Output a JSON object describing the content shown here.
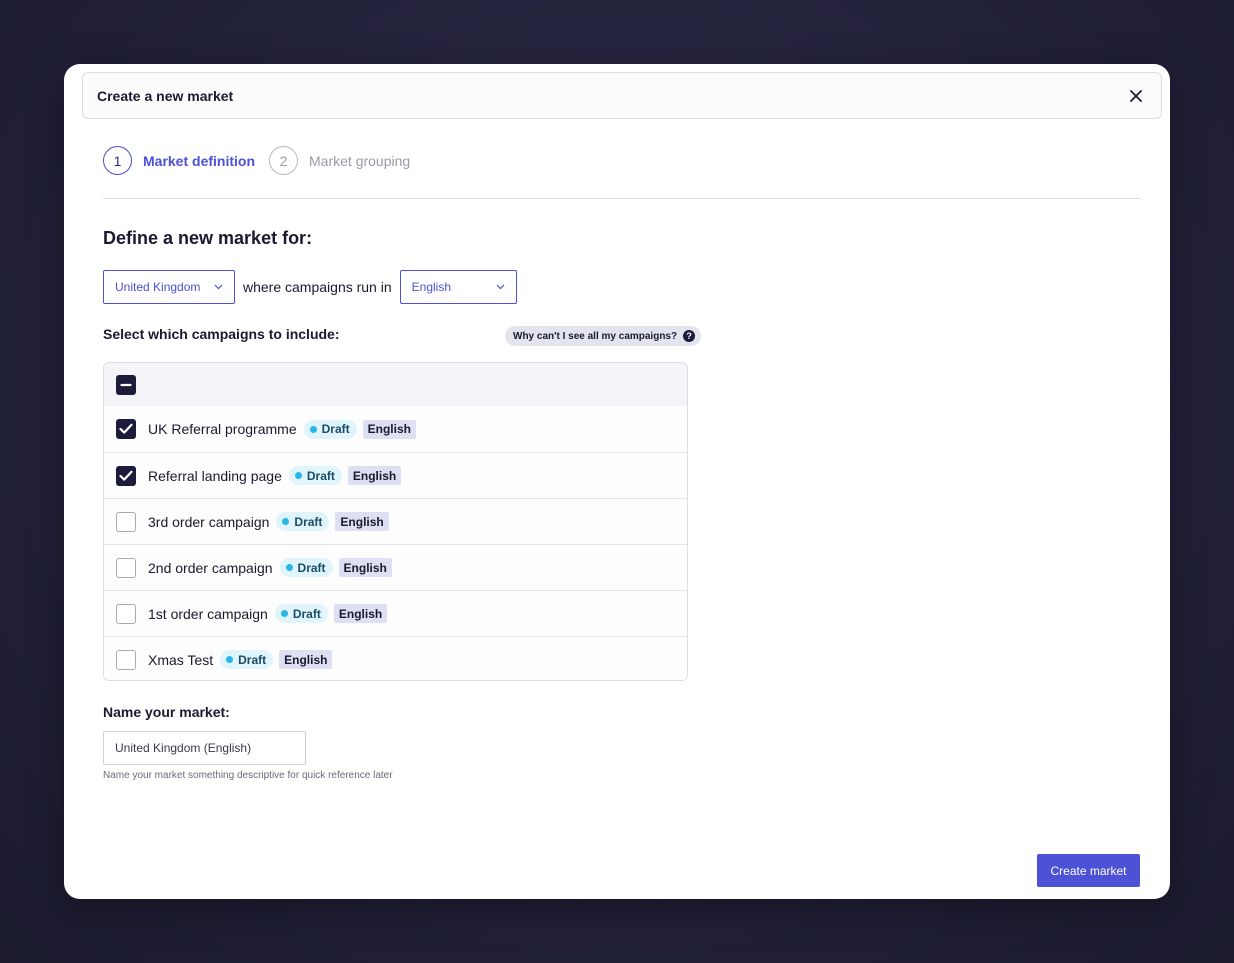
{
  "modal": {
    "title": "Create a new market",
    "close_icon": "close-icon"
  },
  "steps": [
    {
      "number": "1",
      "label": "Market definition",
      "active": true
    },
    {
      "number": "2",
      "label": "Market grouping",
      "active": false
    }
  ],
  "define": {
    "title": "Define a new market for:",
    "country": "United Kingdom",
    "connector": "where campaigns run in",
    "language": "English"
  },
  "campaigns": {
    "label": "Select which campaigns to include:",
    "help_pill": "Why can't I see all my campaigns?",
    "help_icon_glyph": "?",
    "select_all_state": "indeterminate",
    "items": [
      {
        "name": "UK Referral programme",
        "status": "Draft",
        "language": "English",
        "checked": true
      },
      {
        "name": "Referral landing page",
        "status": "Draft",
        "language": "English",
        "checked": true
      },
      {
        "name": "3rd order campaign",
        "status": "Draft",
        "language": "English",
        "checked": false
      },
      {
        "name": "2nd order campaign",
        "status": "Draft",
        "language": "English",
        "checked": false
      },
      {
        "name": "1st order campaign",
        "status": "Draft",
        "language": "English",
        "checked": false
      },
      {
        "name": "Xmas Test",
        "status": "Draft",
        "language": "English",
        "checked": false
      }
    ]
  },
  "market_name": {
    "label": "Name your market:",
    "value": "United Kingdom (English)",
    "help": "Name your market something descriptive for quick reference later"
  },
  "footer": {
    "create_label": "Create market"
  },
  "colors": {
    "accent": "#4c51d6",
    "dark": "#1c1b3a",
    "status_dot": "#29b6e8",
    "overlay": "#23223a"
  }
}
